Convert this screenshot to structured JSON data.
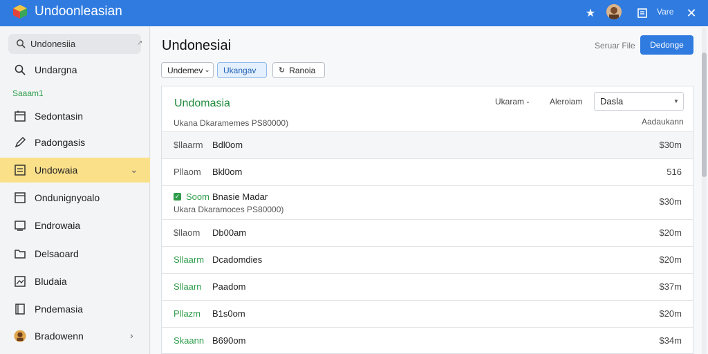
{
  "window": {
    "title": "Undoonleasian",
    "right_label": "Vare",
    "icons": {
      "logo": "app-cube-icon",
      "star": "star-icon",
      "doc": "document-icon",
      "close": "close-icon"
    }
  },
  "sidebar": {
    "search_text": "Undonesiia",
    "section_label": "Saaam1",
    "items": [
      {
        "label": "Undargna",
        "icon": "search-icon"
      },
      {
        "label": "Sedontasin",
        "icon": "calendar-icon"
      },
      {
        "label": "Padongasis",
        "icon": "pen-icon"
      },
      {
        "label": "Undowaia",
        "icon": "list-icon",
        "active": true
      },
      {
        "label": "Ondunignyoalo",
        "icon": "window-icon"
      },
      {
        "label": "Endrowaia",
        "icon": "monitor-icon"
      },
      {
        "label": "Delsaoard",
        "icon": "folder-icon"
      },
      {
        "label": "Bludaia",
        "icon": "image-icon"
      },
      {
        "label": "Pndemasia",
        "icon": "book-icon"
      },
      {
        "label": "Bradowenn",
        "icon": "user-avatar-icon"
      }
    ]
  },
  "main": {
    "title": "Undonesiai",
    "file_label": "Seruar File",
    "primary_button": "Dedonge",
    "chips": [
      "Undemev",
      "Ukangav",
      "Ranoia"
    ],
    "panel": {
      "title": "Undomasia",
      "subtitle": "Ukana Dkaramemes PS80000)",
      "sort_label": "Ukaram",
      "filter_label": "Aleroiam",
      "select_value": "Dasla",
      "right_header": "Aadaukann",
      "rows": [
        {
          "code": "$llaarm",
          "name": "Bdl0om",
          "amount": "$30m",
          "green": false
        },
        {
          "code": "Pllaom",
          "name": "Bkl0om",
          "amount": "516",
          "green": false
        },
        {
          "code": "Soom",
          "name": "Bnasie Madar",
          "amount": "$30m",
          "green": true,
          "sub": "Ukara Dkaramoces PS80000)",
          "check": true
        },
        {
          "code": "$llaom",
          "name": "Db00am",
          "amount": "$20m",
          "green": false
        },
        {
          "code": "Sllaarm",
          "name": "Dcadomdies",
          "amount": "$20m",
          "green": true
        },
        {
          "code": "Sllaarn",
          "name": "Paadom",
          "amount": "$37m",
          "green": true
        },
        {
          "code": "Pllazm",
          "name": "B1s0om",
          "amount": "$20m",
          "green": true
        },
        {
          "code": "Skaann",
          "name": "B690om",
          "amount": "$34m",
          "green": true
        }
      ]
    }
  },
  "colors": {
    "accent": "#2f7be0",
    "active_item": "#fbe08a",
    "green": "#2e9c4a"
  }
}
